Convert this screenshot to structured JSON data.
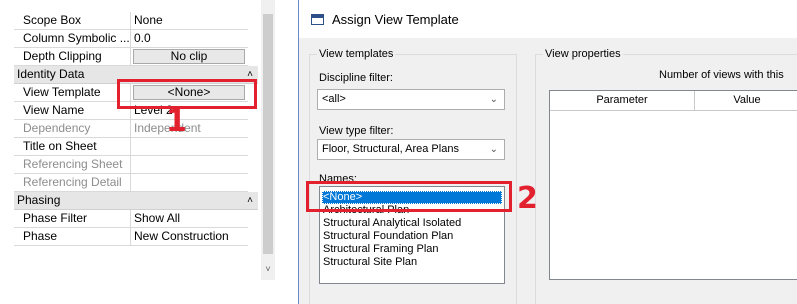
{
  "properties": {
    "rows": [
      {
        "name": "Scope Box",
        "value": "None"
      },
      {
        "name": "Column Symbolic ...",
        "value": "0.0"
      },
      {
        "name": "Depth Clipping",
        "value": "No clip"
      },
      {
        "name": "View Template",
        "value": "<None>"
      },
      {
        "name": "View Name",
        "value": "Level 2"
      },
      {
        "name": "Dependency",
        "value": "Independent"
      },
      {
        "name": "Title on Sheet",
        "value": ""
      },
      {
        "name": "Referencing Sheet",
        "value": ""
      },
      {
        "name": "Referencing Detail",
        "value": ""
      },
      {
        "name": "Phase Filter",
        "value": "Show All"
      },
      {
        "name": "Phase",
        "value": "New Construction"
      }
    ],
    "groups": {
      "identity_data": "Identity Data",
      "phasing": "Phasing"
    },
    "collapse_glyph": "˄",
    "scroll_down_glyph": "˅"
  },
  "dialog": {
    "title": "Assign View Template",
    "view_templates_label": "View templates",
    "discipline_filter_label": "Discipline filter:",
    "discipline_filter_value": "<all>",
    "view_type_filter_label": "View type filter:",
    "view_type_filter_value": "Floor, Structural, Area Plans",
    "names_label": "Names:",
    "names": [
      "<None>",
      "Architectural Plan",
      "Structural Analytical Isolated",
      "Structural Foundation Plan",
      "Structural Framing Plan",
      "Structural Site Plan"
    ],
    "view_properties_label": "View properties",
    "views_count_text": "Number of views with this",
    "table_headers": [
      "Parameter",
      "Value"
    ]
  },
  "annotations": {
    "marker_1": "1",
    "marker_2": "2",
    "color": "#e3202e"
  },
  "icons": {
    "dropdown": "chevron-down-icon",
    "title": "dialog-icon"
  }
}
